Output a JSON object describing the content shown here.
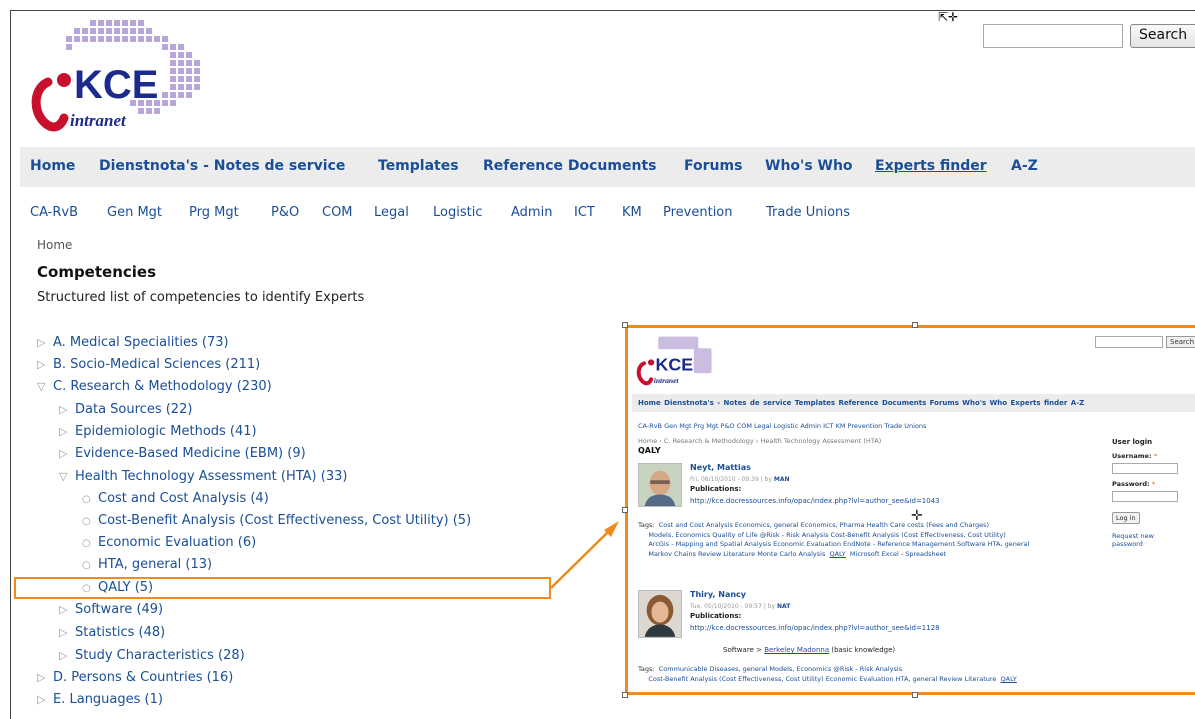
{
  "search": {
    "placeholder": "",
    "button_label": "Search"
  },
  "logo": {
    "text": "KCE",
    "subtext": "intranet"
  },
  "main_nav": [
    "Home",
    "Dienstnota's - Notes de service",
    "Templates",
    "Reference Documents",
    "Forums",
    "Who's Who",
    "Experts finder",
    "A-Z"
  ],
  "sub_nav": [
    "CA-RvB",
    "Gen Mgt",
    "Prg Mgt",
    "P&O",
    "COM",
    "Legal",
    "Logistic",
    "Admin",
    "ICT",
    "KM",
    "Prevention",
    "Trade Unions"
  ],
  "breadcrumb": "Home",
  "page_title": "Competencies",
  "page_description": "Structured list of competencies to identify Experts",
  "tree": [
    "A. Medical Specialities (73)",
    "B. Socio-Medical Sciences (211)",
    "C. Research & Methodology (230)",
    "Data Sources (22)",
    "Epidemiologic Methods (41)",
    "Evidence-Based Medicine (EBM) (9)",
    "Health Technology Assessment (HTA) (33)",
    "Cost and Cost Analysis (4)",
    "Cost-Benefit Analysis (Cost Effectiveness, Cost Utility) (5)",
    "Economic Evaluation (6)",
    "HTA, general (13)",
    "QALY (5)",
    "Software (49)",
    "Statistics (48)",
    "Study Characteristics (28)",
    "D. Persons & Countries (16)",
    "E. Languages (1)"
  ],
  "inset": {
    "search_button": "Search",
    "nav": "Home   Dienstnota's - Notes de service   Templates   Reference Documents   Forums   Who's Who   Experts finder   A-Z",
    "sub_nav": "CA-RvB   Gen Mgt   Prg Mgt   P&O   COM   Legal   Logistic   Admin   ICT   KM   Prevention   Trade Unions",
    "breadcrumb": "Home › C. Research & Methodology › Health Technology Assessment (HTA)",
    "title": "QALY",
    "experts": [
      {
        "name": "Neyt, Mattias",
        "meta_prefix": "Fri, 08/10/2010 - 09:39 | by ",
        "meta_user": "MAN",
        "publications_label": "Publications:",
        "publications_link": "http://kce.docressources.info/opac/index.php?lvl=author_see&id=1043",
        "tags_label": "Tags:",
        "tags_lines": [
          "Cost and Cost Analysis   Economics, general   Economics, Pharma   Health Care costs (Fees and Charges)",
          "Models, Economics   Quality of Life   @Risk - Risk Analysis   Cost-Benefit Analysis (Cost Effectiveness, Cost Utility)",
          "ArcGis - Mapping and Spatial Analysis   Economic Evaluation   EndNote - Reference Management Software   HTA, general",
          "Markov Chains   Review Literature   Monte Carlo Analysis"
        ],
        "tags_qaly": "QALY",
        "tags_tail": "Microsoft Excel - Spreadsheet"
      },
      {
        "name": "Thiry, Nancy",
        "meta_prefix": "Tue, 05/10/2010 - 09:57 | by ",
        "meta_user": "NAT",
        "publications_label": "Publications:",
        "publications_link": "http://kce.docressources.info/opac/index.php?lvl=author_see&id=1128",
        "software_label": "Software > ",
        "software_link": "Berkeley Madonna",
        "software_note": " (basic knowledge)",
        "tags_label": "Tags:",
        "tags_lines": [
          "Communicable Diseases, general   Models, Economics   @Risk - Risk Analysis",
          "Cost-Benefit Analysis (Cost Effectiveness, Cost Utility)   Economic Evaluation   HTA, general   Review Literature"
        ],
        "tags_qaly": "QALY"
      }
    ],
    "login": {
      "title": "User login",
      "username_label": "Username:",
      "password_label": "Password:",
      "required_mark": "*",
      "button": "Log in",
      "request_link": "Request new password"
    }
  },
  "colors": {
    "link": "#1a4e96",
    "highlight": "#f08a1c",
    "nav_bg": "#ececec"
  },
  "icons": {
    "collapsed": "triangle-right-icon",
    "expanded": "triangle-down-icon",
    "leaf": "circle-icon",
    "cursor": "mouse-pointer-icon",
    "move": "move-crosshair-icon"
  }
}
